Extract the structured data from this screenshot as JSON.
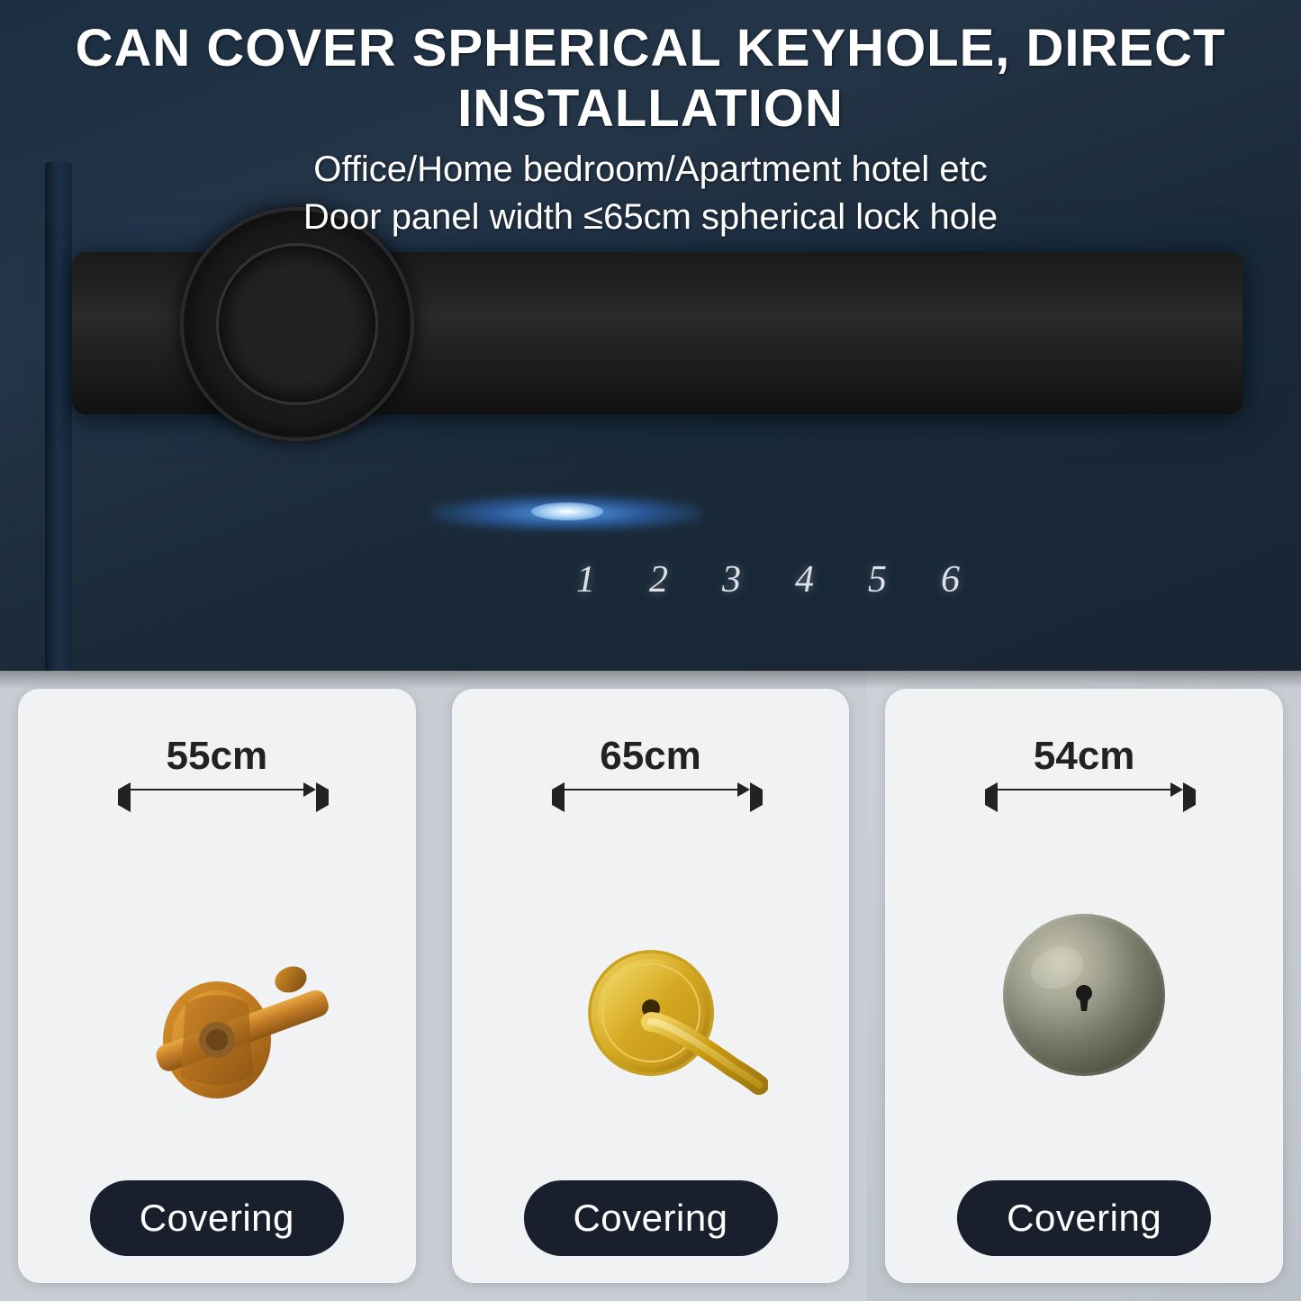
{
  "header": {
    "main_title": "CAN COVER SPHERICAL KEYHOLE, DIRECT INSTALLATION",
    "sub_title_1": "Office/Home bedroom/Apartment hotel etc",
    "sub_title_2": "Door panel width ≤65cm spherical lock hole"
  },
  "lock": {
    "numbers": [
      "1",
      "2",
      "3",
      "4",
      "5",
      "6"
    ]
  },
  "cards": [
    {
      "id": "card-1",
      "measurement": "55cm",
      "handle_type": "bronze_lever",
      "badge_label": "Covering"
    },
    {
      "id": "card-2",
      "measurement": "65cm",
      "handle_type": "gold_lever",
      "badge_label": "Covering"
    },
    {
      "id": "card-3",
      "measurement": "54cm",
      "handle_type": "round_knob",
      "badge_label": "Covering"
    }
  ]
}
